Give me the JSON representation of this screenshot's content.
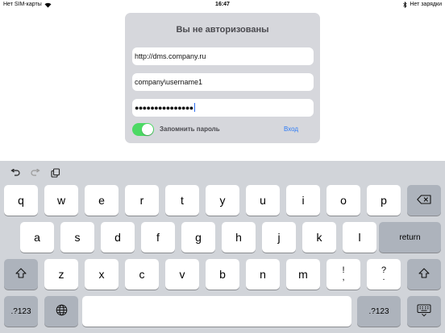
{
  "status": {
    "carrier": "Нет SIM-карты",
    "time": "16:47",
    "battery": "Нет зарядки"
  },
  "dialog": {
    "title": "Вы не авторизованы",
    "server_url": "http://dms.company.ru",
    "username": "company\\username1",
    "password_masked": "●●●●●●●●●●●●●●●",
    "remember_label": "Запомнить пароль",
    "remember_on": true,
    "login_label": "Вход",
    "accent_color": "#2f7cf6",
    "toggle_color": "#4cd964"
  },
  "keyboard": {
    "shortcuts": [
      "undo-icon",
      "redo-icon",
      "paste-icon"
    ],
    "row1": [
      "q",
      "w",
      "e",
      "r",
      "t",
      "y",
      "u",
      "i",
      "o",
      "p"
    ],
    "row2": [
      "a",
      "s",
      "d",
      "f",
      "g",
      "h",
      "j",
      "k",
      "l"
    ],
    "row3": [
      "z",
      "x",
      "c",
      "v",
      "b",
      "n",
      "m"
    ],
    "punct1_top": "!",
    "punct1_bottom": ",",
    "punct2_top": "?",
    "punct2_bottom": ".",
    "return_label": "return",
    "numbers_label": ".?123",
    "icons": [
      "backspace-icon",
      "shift-icon",
      "globe-icon",
      "keyboard-dismiss-icon"
    ]
  }
}
